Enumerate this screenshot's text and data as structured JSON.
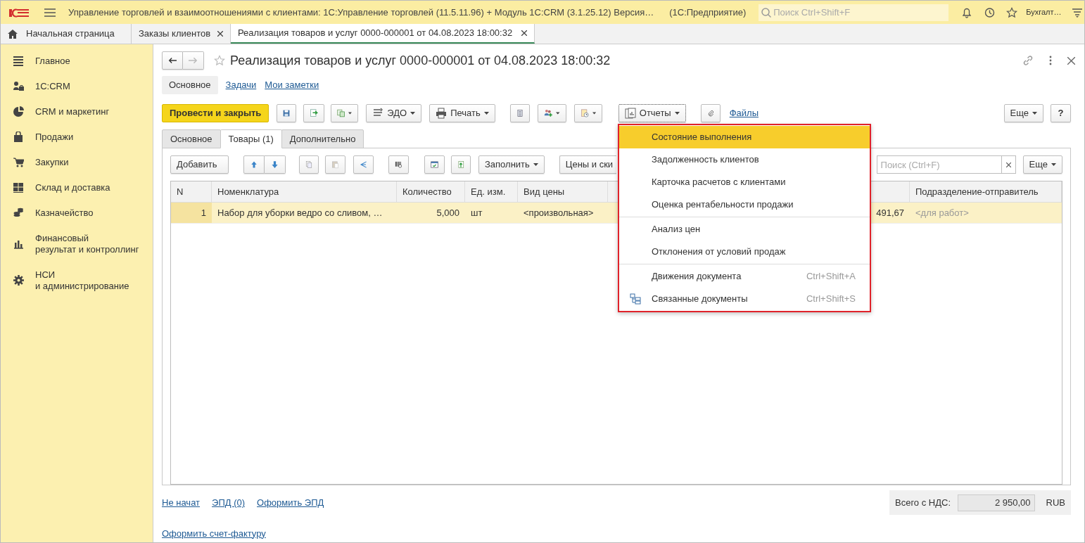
{
  "app_title": "Управление торговлей и взаимоотношениями с клиентами: 1С:Управление торговлей (11.5.11.96) + Модуль 1С:CRM (3.1.25.12) Версия…",
  "platform": "(1С:Предприятие)",
  "global_search": {
    "placeholder": "Поиск Ctrl+Shift+F"
  },
  "user": "Бухгалт…",
  "window_tabs": [
    {
      "label": "Начальная страница",
      "kind": "home",
      "selected": false
    },
    {
      "label": "Заказы клиентов",
      "kind": "closable",
      "selected": false
    },
    {
      "label": "Реализация товаров и услуг 0000-000001 от 04.08.2023 18:00:32",
      "kind": "closable",
      "selected": true
    }
  ],
  "sidebar": {
    "items": [
      {
        "label": "Главное",
        "kind": "menu"
      },
      {
        "label": "1С:CRM",
        "kind": "people"
      },
      {
        "label": "CRM и маркетинг",
        "kind": "pie"
      },
      {
        "label": "Продажи",
        "kind": "bag"
      },
      {
        "label": "Закупки",
        "kind": "cart"
      },
      {
        "label": "Склад и доставка",
        "kind": "grid"
      },
      {
        "label": "Казначейство",
        "kind": "coins"
      },
      {
        "label": "Финансовый\nрезультат и контроллинг",
        "kind": "chart"
      },
      {
        "label": "НСИ\nи администрирование",
        "kind": "gear"
      }
    ]
  },
  "document": {
    "title": "Реализация товаров и услуг 0000-000001 от 04.08.2023 18:00:32",
    "views": [
      {
        "label": "Основное",
        "selected": true
      },
      {
        "label": "Задачи",
        "selected": false
      },
      {
        "label": "Мои заметки",
        "selected": false
      }
    ],
    "actions": {
      "post_close": "Провести и закрыть",
      "edo": "ЭДО",
      "print": "Печать",
      "reports": "Отчеты",
      "files": "Файлы",
      "more": "Еще",
      "help": "?"
    },
    "tabs": [
      {
        "label": "Основное",
        "selected": false
      },
      {
        "label": "Товары (1)",
        "selected": true
      },
      {
        "label": "Дополнительно",
        "selected": false
      }
    ],
    "goods": {
      "add": "Добавить",
      "fill": "Заполнить",
      "prices": "Цены и ски",
      "search": {
        "placeholder": "Поиск (Ctrl+F)"
      },
      "more": "Еще",
      "columns": [
        {
          "label": "N"
        },
        {
          "label": "Номенклатура"
        },
        {
          "label": "Количество"
        },
        {
          "label": "Ед. изм."
        },
        {
          "label": "Вид цены"
        },
        {},
        {
          "label": "Подразделение-отправитель"
        }
      ],
      "rows": [
        {
          "selected": true,
          "cells": [
            "1",
            "Набор для уборки ведро со сливом, …",
            "5,000",
            "шт",
            "<произвольная>",
            "491,67",
            "<для работ>"
          ]
        }
      ]
    },
    "footer": {
      "links": [
        "Не начат",
        "ЭПД (0)",
        "Оформить ЭПД"
      ],
      "total_label": "Всего с НДС:",
      "total": "2 950,00",
      "currency": "RUB",
      "invoice_link": "Оформить счет-фактуру"
    }
  },
  "reports_menu": {
    "groups": [
      [
        {
          "label": "Состояние выполнения",
          "kind": "text",
          "selected": true
        },
        {
          "label": "Задолженность клиентов",
          "kind": "text",
          "selected": false
        },
        {
          "label": "Карточка расчетов с клиентами",
          "kind": "text",
          "selected": false
        },
        {
          "label": "Оценка рентабельности продажи",
          "kind": "text",
          "selected": false
        }
      ],
      [
        {
          "label": "Анализ цен",
          "kind": "text",
          "selected": false
        },
        {
          "label": "Отклонения от условий продаж",
          "kind": "text",
          "selected": false
        }
      ],
      [
        {
          "label": "Движения документа",
          "kind": "text",
          "shortcut": "Ctrl+Shift+A",
          "selected": false
        },
        {
          "label": "Связанные документы",
          "kind": "tree",
          "shortcut": "Ctrl+Shift+S",
          "selected": false
        }
      ]
    ]
  }
}
